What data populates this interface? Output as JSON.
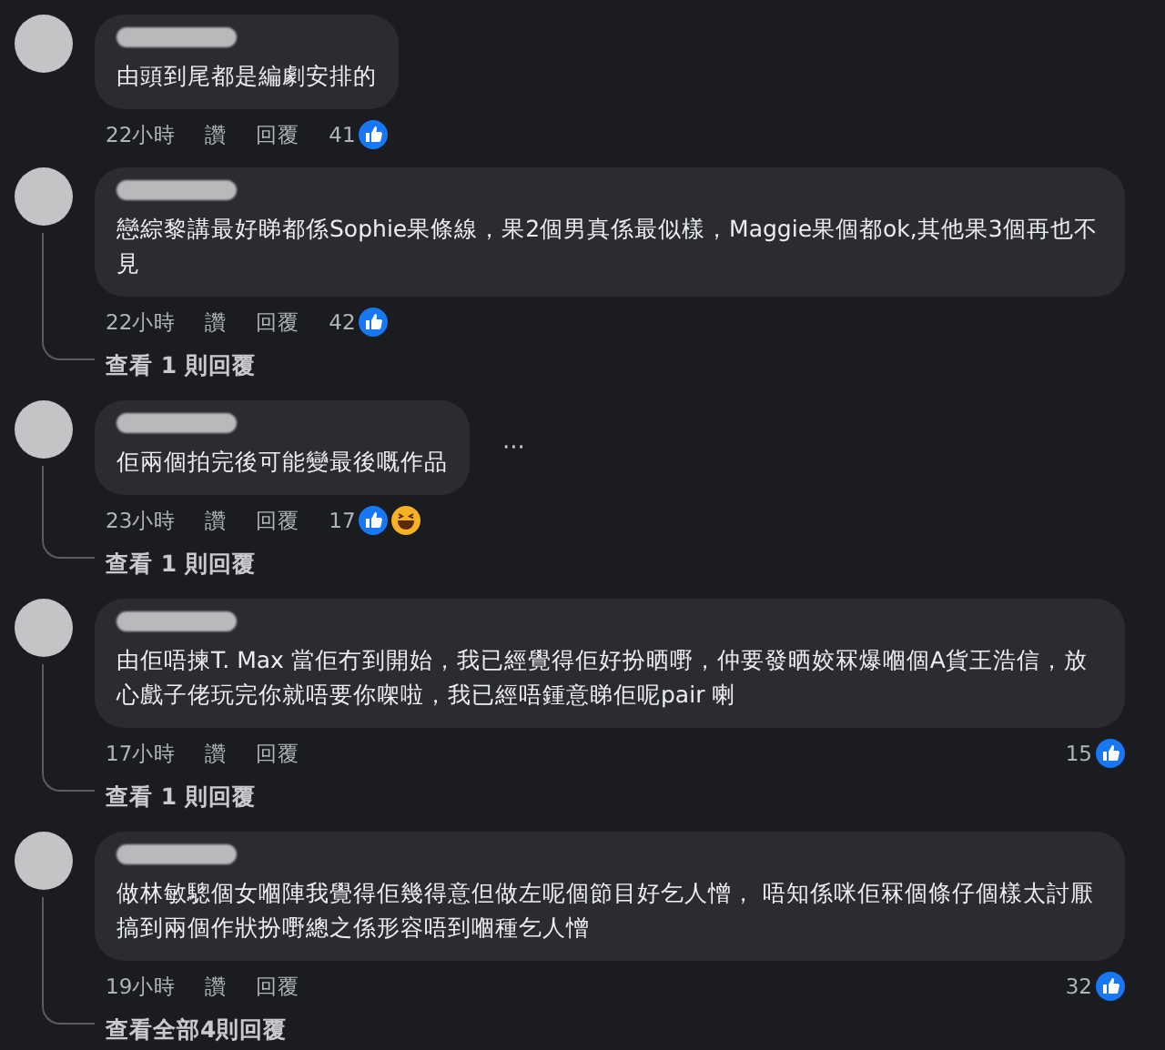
{
  "comments": [
    {
      "text": "由頭到尾都是編劇安排的",
      "time": "22小時",
      "like": "讚",
      "reply": "回覆",
      "count": "41",
      "reactions": [
        {
          "kind": "like"
        }
      ],
      "count_at_end": false
    },
    {
      "text": "戀綜黎講最好睇都係Sophie果條線，果2個男真係最似樣，Maggie果個都ok,其他果3個再也不見",
      "time": "22小時",
      "like": "讚",
      "reply": "回覆",
      "count": "42",
      "reactions": [
        {
          "kind": "like"
        }
      ],
      "count_at_end": false,
      "replies_link": "查看 1 則回覆"
    },
    {
      "text": "佢兩個拍完後可能變最後嘅作品",
      "time": "23小時",
      "like": "讚",
      "reply": "回覆",
      "count": "17",
      "reactions": [
        {
          "kind": "like"
        },
        {
          "kind": "haha"
        }
      ],
      "count_at_end": false,
      "menu": "···",
      "replies_link": "查看 1 則回覆"
    },
    {
      "text": "由佢唔揀T. Max 當佢冇到開始，我已經覺得佢好扮晒嘢，仲要發晒姣冧爆嗰個A貨王浩信，放心戲子佬玩完你就唔要你㗎啦，我已經唔鍾意睇佢呢pair 喇",
      "time": "17小時",
      "like": "讚",
      "reply": "回覆",
      "count": "15",
      "reactions": [
        {
          "kind": "like"
        }
      ],
      "count_at_end": true,
      "replies_link": "查看 1 則回覆"
    },
    {
      "text": "做林敏驄個女嗰陣我覺得佢幾得意但做左呢個節目好乞人憎， 唔知係咪佢冧個條仔個樣太討厭搞到兩個作狀扮嘢總之係形容唔到嗰種乞人憎",
      "time": "19小時",
      "like": "讚",
      "reply": "回覆",
      "count": "32",
      "reactions": [
        {
          "kind": "like"
        }
      ],
      "count_at_end": true,
      "replies_link": "查看全部4則回覆"
    }
  ]
}
